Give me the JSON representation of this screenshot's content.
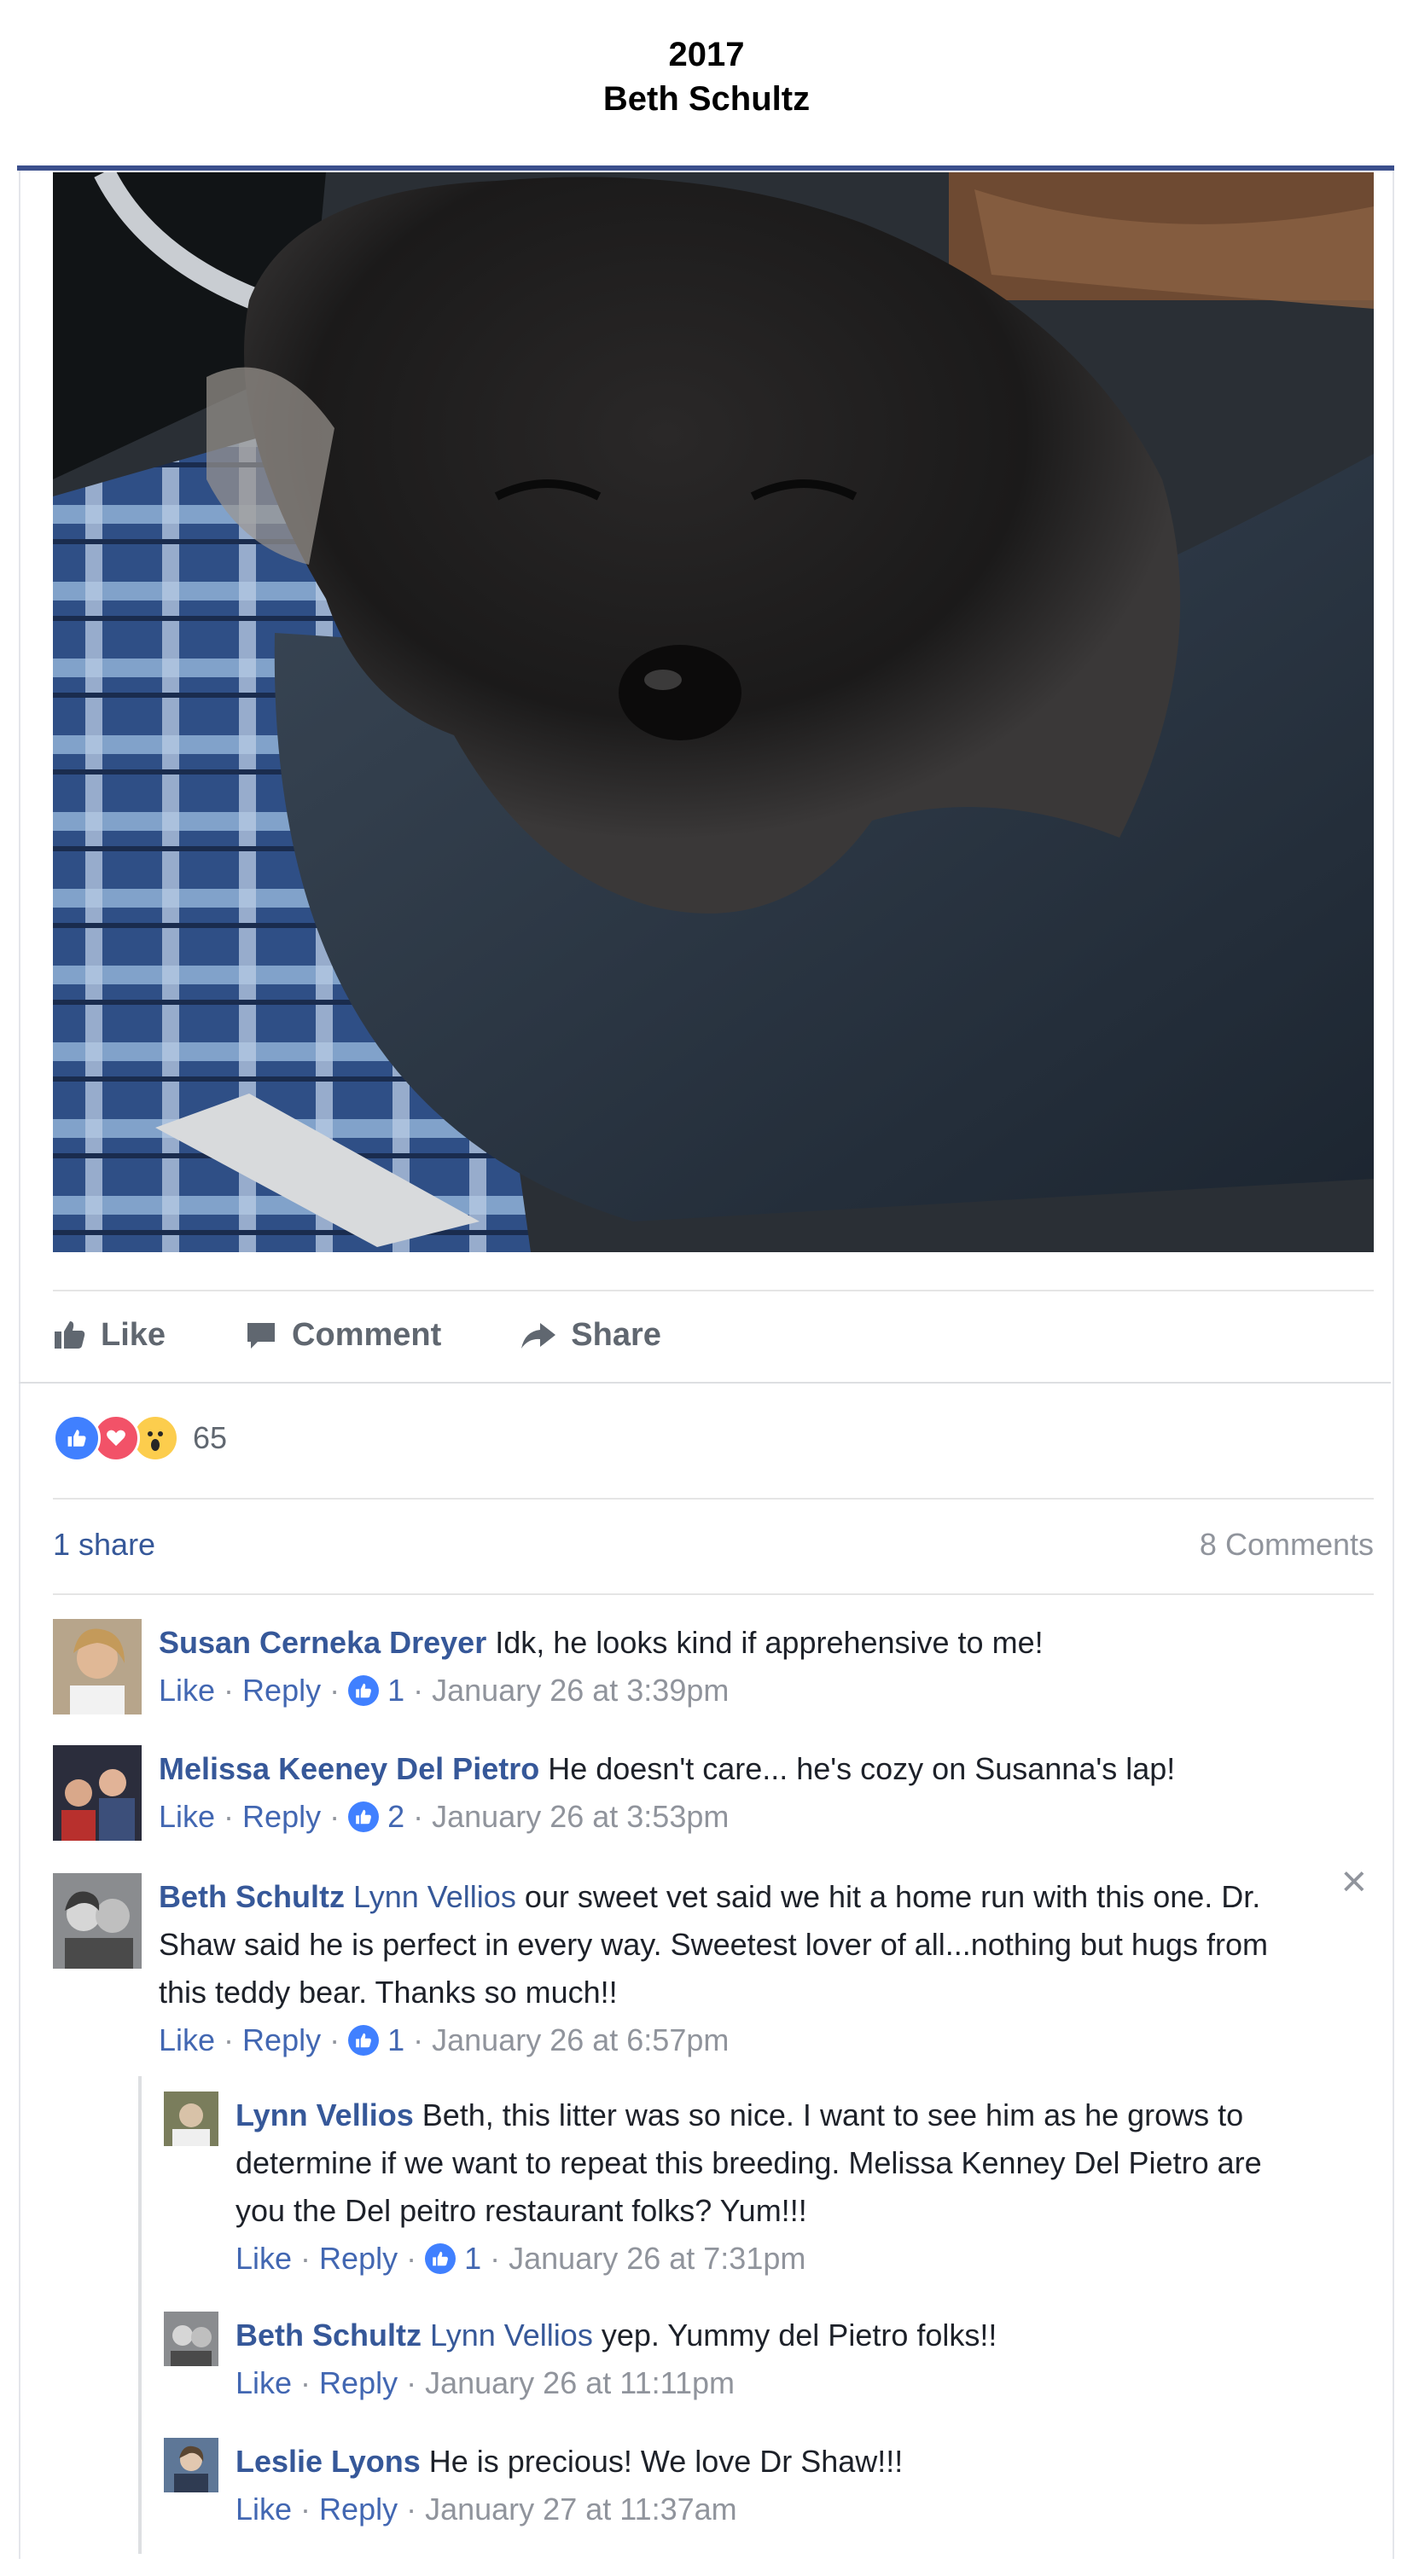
{
  "header": {
    "year": "2017",
    "name": "Beth Schultz"
  },
  "colors": {
    "rule": "#3b4f8c",
    "link": "#365899",
    "meta": "#90949c",
    "like_blue": "#4080ff"
  },
  "actions": {
    "like": "Like",
    "comment": "Comment",
    "share": "Share"
  },
  "reactions": {
    "icons": [
      "like-icon",
      "love-icon",
      "wow-icon"
    ],
    "count": "65"
  },
  "stats": {
    "shares": "1 share",
    "comments": "8 Comments"
  },
  "comments": [
    {
      "author": "Susan Cerneka Dreyer",
      "tag": "",
      "text": "Idk, he looks kind if apprehensive to me!",
      "like": "Like",
      "reply": "Reply",
      "likes": "1",
      "time": "January 26 at 3:39pm"
    },
    {
      "author": "Melissa Keeney Del Pietro",
      "tag": "",
      "text": "He doesn't care... he's cozy on Susanna's lap!",
      "like": "Like",
      "reply": "Reply",
      "likes": "2",
      "time": "January 26 at 3:53pm"
    },
    {
      "author": "Beth Schultz",
      "tag": "Lynn Vellios",
      "text": "our sweet vet said we hit a home run with this one. Dr. Shaw said he is perfect in every way. Sweetest lover of all...nothing but hugs from this teddy bear. Thanks so much!!",
      "like": "Like",
      "reply": "Reply",
      "likes": "1",
      "time": "January 26 at 6:57pm"
    }
  ],
  "replies": [
    {
      "author": "Lynn Vellios",
      "tag": "",
      "text": "Beth, this litter was so nice. I want to see him as he grows to determine if we want to repeat this breeding. Melissa Kenney Del Pietro are you the Del peitro restaurant folks? Yum!!!",
      "like": "Like",
      "reply": "Reply",
      "likes": "1",
      "time": "January 26 at 7:31pm"
    },
    {
      "author": "Beth Schultz",
      "tag": "Lynn Vellios",
      "text": "yep. Yummy del Pietro folks!!",
      "like": "Like",
      "reply": "Reply",
      "likes": "",
      "time": "January 26 at 11:11pm"
    },
    {
      "author": "Leslie Lyons",
      "tag": "",
      "text": "He is precious! We love Dr Shaw!!!",
      "like": "Like",
      "reply": "Reply",
      "likes": "",
      "time": "January 27 at 11:37am"
    }
  ],
  "close_glyph": "×"
}
